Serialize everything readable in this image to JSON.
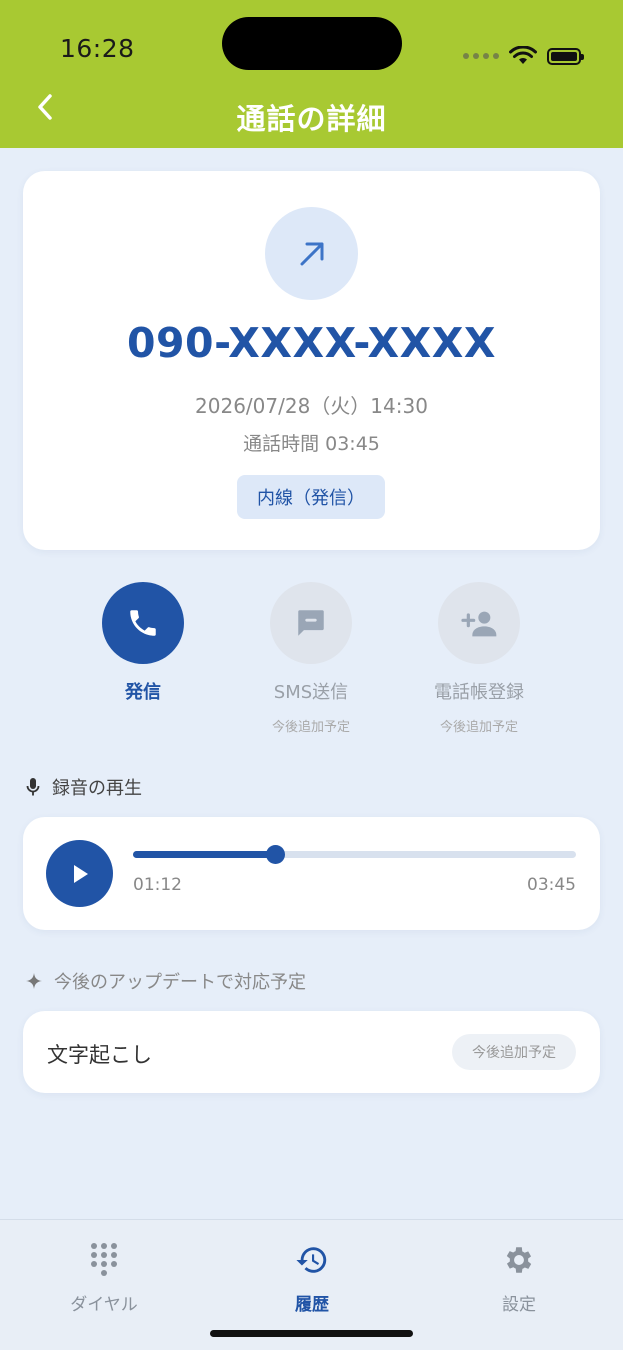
{
  "status_bar": {
    "time": "16:28"
  },
  "header": {
    "title": "通話の詳細",
    "back_icon": "chevron-left-icon"
  },
  "call": {
    "direction_icon": "outgoing-arrow-icon",
    "number": "090-XXXX-XXXX",
    "datetime": "2026/07/28（火）14:30",
    "duration": "通話時間 03:45",
    "type": "内線（発信）"
  },
  "actions": [
    {
      "label": "発信",
      "sub": "",
      "icon": "phone-icon",
      "enabled": true
    },
    {
      "label": "SMS送信",
      "sub": "今後追加予定",
      "icon": "message-icon",
      "enabled": false
    },
    {
      "label": "電話帳登録",
      "sub": "今後追加予定",
      "icon": "add-contact-icon",
      "enabled": false
    }
  ],
  "recording": {
    "section_title": "録音の再生",
    "current": "01:12",
    "total": "03:45",
    "progress": 0.32
  },
  "upcoming": {
    "section_title": "今後のアップデートで対応予定",
    "item_label": "文字起こし",
    "item_badge": "今後追加予定"
  },
  "nav": [
    {
      "label": "ダイヤル",
      "icon": "dialpad-icon",
      "active": false
    },
    {
      "label": "履歴",
      "icon": "history-icon",
      "active": true
    },
    {
      "label": "設定",
      "icon": "gear-icon",
      "active": false
    }
  ],
  "colors": {
    "header": "#a8c932",
    "accent": "#2154a6",
    "background": "#e6eef9"
  }
}
